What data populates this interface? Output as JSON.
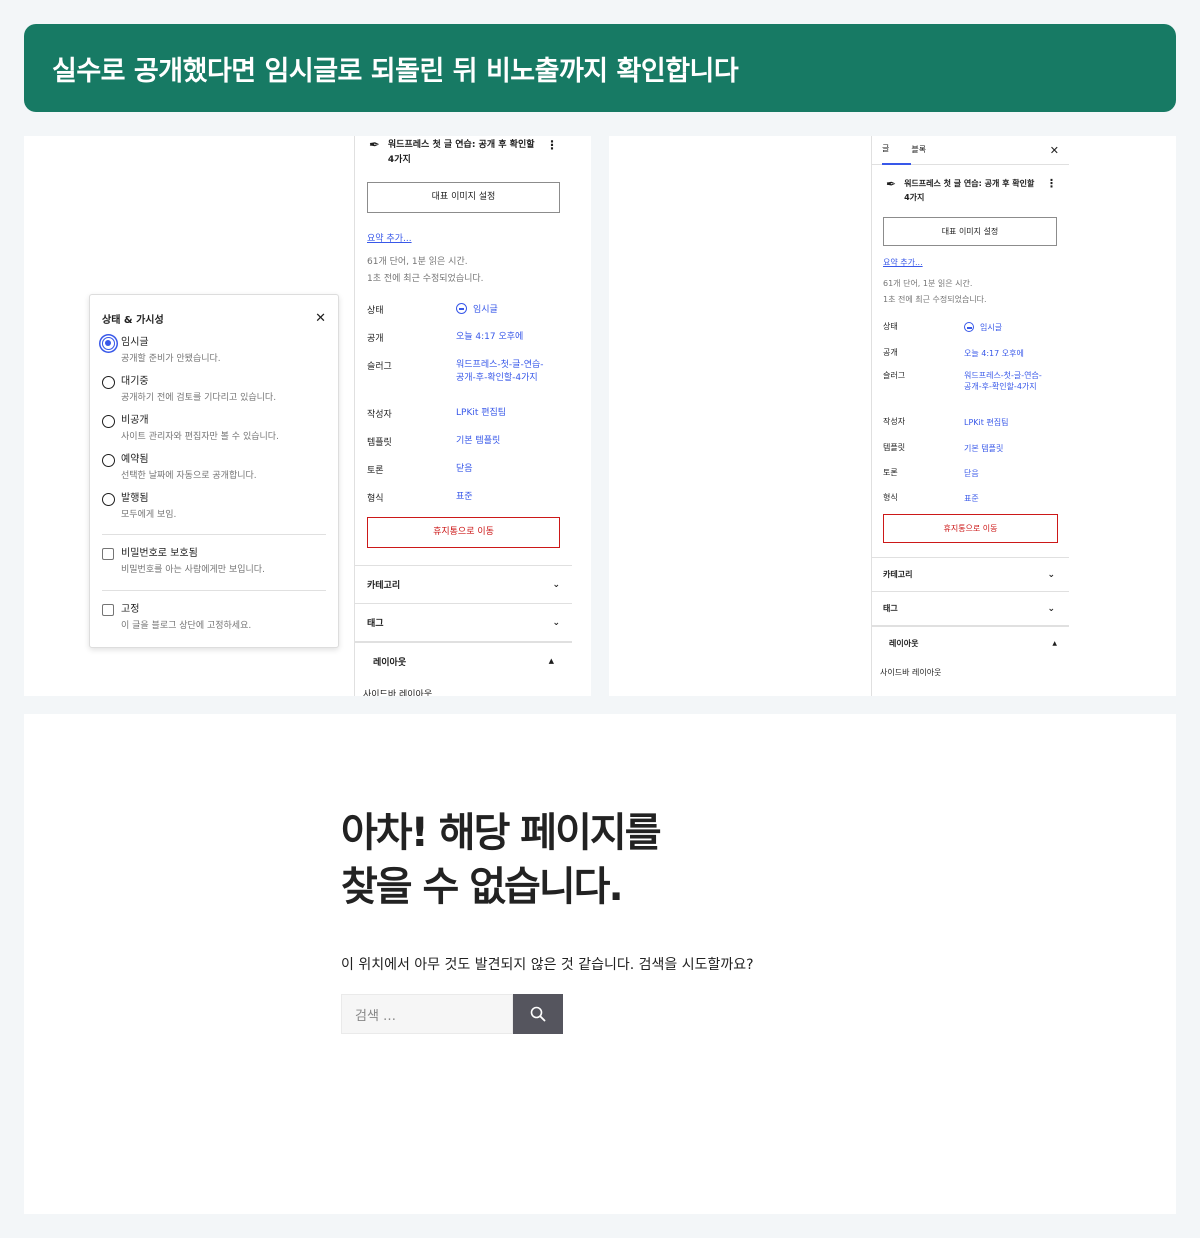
{
  "banner": {
    "title": "실수로 공개했다면 임시글로 되돌린 뒤 비노출까지 확인합니다"
  },
  "status_popover": {
    "title": "상태 & 가시성",
    "options": [
      {
        "label": "임시글",
        "desc": "공개할 준비가 안됐습니다."
      },
      {
        "label": "대기중",
        "desc": "공개하기 전에 검토를 기다리고 있습니다."
      },
      {
        "label": "비공개",
        "desc": "사이트 관리자와 편집자만 볼 수 있습니다."
      },
      {
        "label": "예약됨",
        "desc": "선택한 날짜에 자동으로 공개합니다."
      },
      {
        "label": "발행됨",
        "desc": "모두에게 보임."
      }
    ],
    "password": {
      "label": "비밀번호로 보호됨",
      "desc": "비밀번호를 아는 사람에게만 보입니다."
    },
    "sticky": {
      "label": "고정",
      "desc": "이 글을 블로그 상단에 고정하세요."
    }
  },
  "post_sidebar": {
    "tabs": [
      "글",
      "블록"
    ],
    "title": "워드프레스 첫 글 연습: 공개 후 확인할 4가지",
    "featured_image_button": "대표 이미지 설정",
    "excerpt_link": "요약 추가...",
    "word_count": "61개 단어, 1분 읽은 시간.",
    "last_edited": "1초 전에 최근 수정되었습니다.",
    "rows": [
      {
        "key": "상태",
        "value": "임시글"
      },
      {
        "key": "공개",
        "value": "오늘 4:17 오후에"
      },
      {
        "key": "슬러그",
        "value": "워드프레스-첫-글-연습-공개-후-확인할-4가지"
      },
      {
        "key": "작성자",
        "value": "LPKit 편집팀"
      },
      {
        "key": "템플릿",
        "value": "기본 템플릿"
      },
      {
        "key": "토론",
        "value": "닫음"
      },
      {
        "key": "형식",
        "value": "표준"
      }
    ],
    "trash_button": "휴지통으로 이동",
    "sections": {
      "category": "카테고리",
      "tags": "태그",
      "layout": "레이아웃",
      "sidebar_layout": "사이드바 레이아웃"
    }
  },
  "not_found": {
    "heading_line1": "아차! 해당 페이지를",
    "heading_line2": "찾을 수 없습니다.",
    "message": "이 위치에서 아무 것도 발견되지 않은 것 같습니다. 검색을 시도할까요?",
    "search_placeholder": "검색 …"
  }
}
